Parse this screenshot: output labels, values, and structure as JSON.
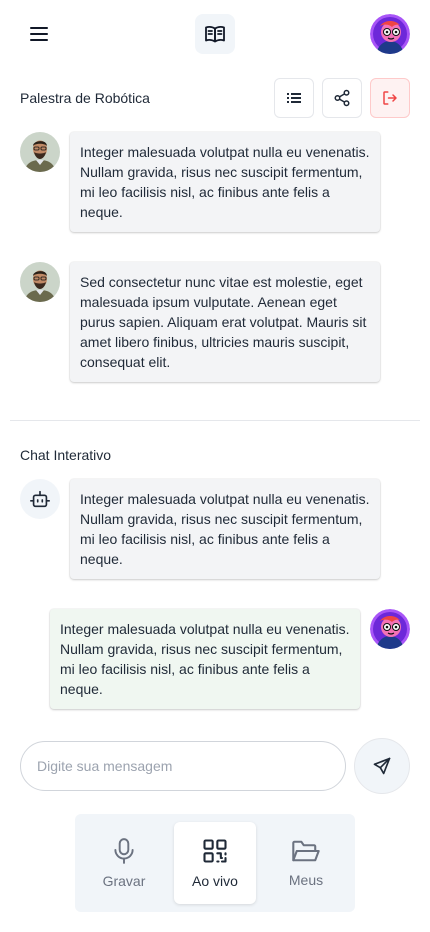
{
  "header": {
    "menu_icon": "hamburger-menu-icon",
    "logo_icon": "open-book-icon",
    "user_avatar": "cartoon-avatar"
  },
  "palestra": {
    "title": "Palestra de Robótica",
    "actions": {
      "list_icon": "list-icon",
      "share_icon": "share-icon",
      "logout_icon": "logout-icon",
      "logout_color": "#ef4444"
    },
    "messages": [
      {
        "author": "speaker",
        "text": "Integer malesuada volutpat nulla eu venenatis. Nullam gravida, risus nec suscipit fermentum, mi leo facilisis nisl, ac finibus ante felis a  neque."
      },
      {
        "author": "speaker",
        "text": "Sed consectetur nunc vitae est molestie, eget malesuada ipsum vulputate. Aenean eget purus sapien. Aliquam erat volutpat. Mauris sit amet libero  finibus, ultricies mauris suscipit, consequat elit."
      }
    ]
  },
  "chat": {
    "title": "Chat Interativo",
    "messages": [
      {
        "author": "bot",
        "text": "Integer malesuada volutpat nulla eu venenatis. Nullam gravida, risus nec suscipit fermentum, mi leo facilisis nisl, ac finibus ante felis a  neque."
      },
      {
        "author": "user",
        "text": "Integer malesuada volutpat nulla eu venenatis. Nullam gravida, risus nec suscipit fermentum, mi leo facilisis nisl, ac finibus ante felis a  neque."
      }
    ]
  },
  "composer": {
    "placeholder": "Digite sua mensagem",
    "value": "",
    "send_icon": "send-icon"
  },
  "bottom_nav": {
    "active": "Ao vivo",
    "items": [
      {
        "label": "Gravar",
        "icon": "microphone-icon"
      },
      {
        "label": "Ao vivo",
        "icon": "qr-code-icon"
      },
      {
        "label": "Meus",
        "icon": "folder-icon"
      }
    ]
  }
}
